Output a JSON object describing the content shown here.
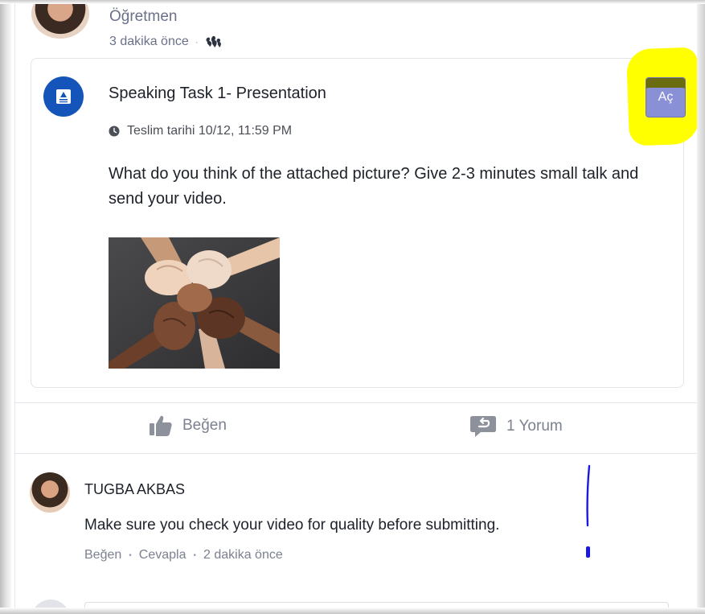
{
  "post": {
    "author_role": "Öğretmen",
    "time_ago": "3 dakika önce",
    "separator": "·",
    "audience_icon": "group-icon"
  },
  "assignment": {
    "icon": "assignment-icon",
    "title": "Speaking Task 1- Presentation",
    "due_label": "Teslim tarihi 10/12, 11:59 PM",
    "description": "What do you think of the attached picture? Give 2-3 minutes small talk and send your video.",
    "open_button_label": "Aç",
    "image_alt": "attached picture of four hands holding wrists",
    "highlight_color": "#ffff00",
    "icon_color": "#1554b8",
    "button_color": "#8a90d6"
  },
  "actions": {
    "like_label": "Beğen",
    "comment_label": "1 Yorum"
  },
  "comment": {
    "author": "TUGBA AKBAS",
    "text": "Make sure you check your video for quality before submitting.",
    "like_label": "Beğen",
    "reply_label": "Cevapla",
    "time_ago": "2 dakika önce",
    "dot": "•"
  },
  "annotation": {
    "pen_color": "#1a1adf"
  }
}
